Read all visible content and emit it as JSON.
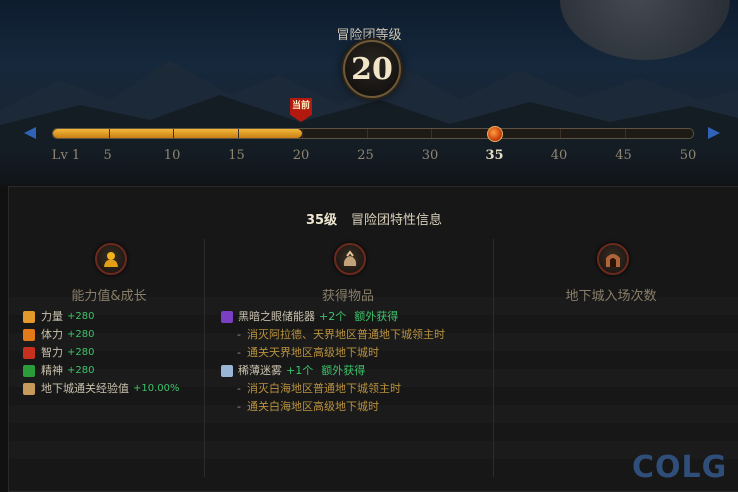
{
  "header": {
    "title": "冒险团等级",
    "level": "20",
    "current_tag": "当前"
  },
  "progress": {
    "current_level": 20,
    "selected_level": 35,
    "max_level": 50,
    "ticks": [
      "Lv 1",
      "5",
      "10",
      "15",
      "20",
      "25",
      "30",
      "35",
      "40",
      "45",
      "50"
    ],
    "active_tick": "35"
  },
  "panel": {
    "level": "35级",
    "title": "冒险团特性信息",
    "columns": [
      {
        "title": "能力值&成长",
        "icon": "muscle-armor-icon"
      },
      {
        "title": "获得物品",
        "icon": "item-bag-icon"
      },
      {
        "title": "地下城入场次数",
        "icon": "dungeon-gate-icon"
      }
    ],
    "stats": [
      {
        "label": "力量",
        "value": "+280",
        "icon": "strength-icon"
      },
      {
        "label": "体力",
        "value": "+280",
        "icon": "vitality-icon"
      },
      {
        "label": "智力",
        "value": "+280",
        "icon": "intelligence-icon"
      },
      {
        "label": "精神",
        "value": "+280",
        "icon": "spirit-icon"
      },
      {
        "label": "地下城通关经验值",
        "value": "+10.00%",
        "icon": "dungeon-exp-icon"
      }
    ],
    "items": [
      {
        "name": "黑暗之眼储能器",
        "count": "+2个",
        "extra": "额外获得",
        "icon": "dark-eye-icon",
        "conditions": [
          "消灭阿拉德、天界地区普通地下城领主时",
          "通关天界地区高级地下城时"
        ]
      },
      {
        "name": "稀薄迷雾",
        "count": "+1个",
        "extra": "额外获得",
        "icon": "mist-icon",
        "conditions": [
          "消灭白海地区普通地下城领主时",
          "通关白海地区高级地下城时"
        ]
      }
    ],
    "dash": "-"
  },
  "watermark": "COLG",
  "colors": {
    "bar_fill": "#e0a12a",
    "accent_green": "#3cc36a",
    "condition_text": "#b9923f",
    "arrow_blue": "#2f63b8"
  }
}
